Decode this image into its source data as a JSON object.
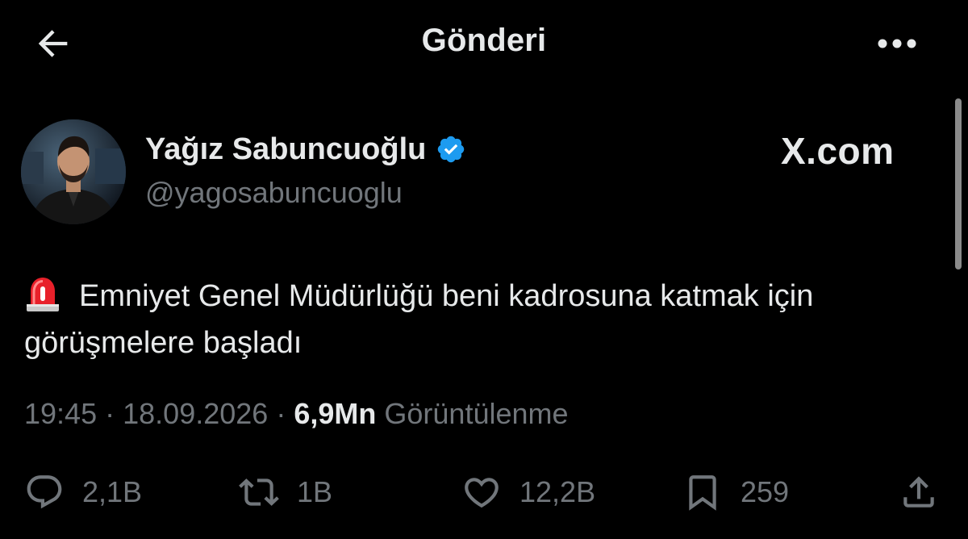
{
  "header": {
    "title": "Gönderi",
    "back_icon": "arrow-left-icon",
    "more_icon": "more-horizontal-icon"
  },
  "author": {
    "display_name": "Yağız Sabuncuoğlu",
    "handle": "@yagosabuncuoglu",
    "verified": true,
    "verified_color": "#1d9bf0"
  },
  "brand": {
    "label": "X.com"
  },
  "tweet": {
    "emoji": "siren-icon",
    "text": "Emniyet Genel Müdürlüğü beni kadrosuna katmak için görüşmelere başladı"
  },
  "meta": {
    "time": "19:45",
    "separator": "·",
    "date": "18.09.2026",
    "views_count": "6,9Mn",
    "views_label": "Görüntülenme"
  },
  "actions": {
    "replies": "2,1B",
    "reposts": "1B",
    "likes": "12,2B",
    "bookmarks": "259"
  },
  "colors": {
    "background": "#000000",
    "text_primary": "#e7e9ea",
    "text_secondary": "#71767b",
    "accent": "#1d9bf0"
  }
}
